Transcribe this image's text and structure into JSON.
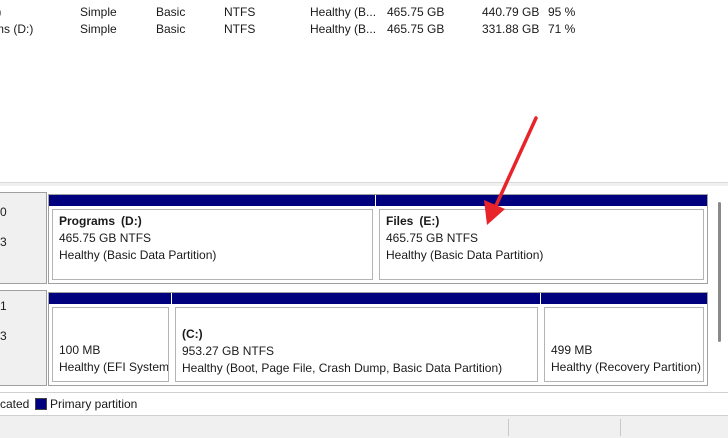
{
  "volumes": [
    {
      "name": ":)",
      "layout": "Simple",
      "type": "Basic",
      "fs": "NTFS",
      "status": "Healthy (B...",
      "capacity": "465.75 GB",
      "free": "440.79 GB",
      "pct": "95 %"
    },
    {
      "name": "ms  (D:)",
      "layout": "Simple",
      "type": "Basic",
      "fs": "NTFS",
      "status": "Healthy (B...",
      "capacity": "465.75 GB",
      "free": "331.88 GB",
      "pct": "71 %"
    }
  ],
  "disks": [
    {
      "label_line1": "0",
      "label_line2": "3",
      "partitions": [
        {
          "title": "Programs",
          "drive": "(D:)",
          "size": "465.75 GB NTFS",
          "status": "Healthy (Basic Data Partition)"
        },
        {
          "title": "Files",
          "drive": "(E:)",
          "size": "465.75 GB NTFS",
          "status": "Healthy (Basic Data Partition)"
        }
      ]
    },
    {
      "label_line1": "1",
      "label_line2": "3",
      "partitions": [
        {
          "title": "",
          "drive": "",
          "size": "100 MB",
          "status": "Healthy (EFI System"
        },
        {
          "title": "",
          "drive": "(C:)",
          "size": "953.27 GB NTFS",
          "status": "Healthy (Boot, Page File, Crash Dump, Basic Data Partition)"
        },
        {
          "title": "",
          "drive": "",
          "size": "499 MB",
          "status": "Healthy (Recovery Partition)"
        }
      ]
    }
  ],
  "legend": {
    "unallocated_label": "cated",
    "primary_label": "Primary partition",
    "unallocated_color": "#000000",
    "primary_color": "#00007f"
  },
  "annotation": {
    "color": "#e8242a"
  }
}
